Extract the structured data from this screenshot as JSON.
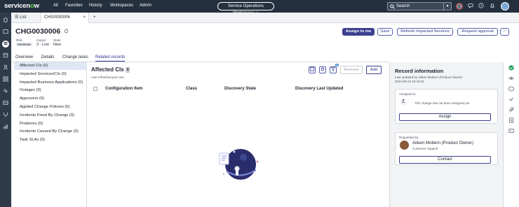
{
  "topnav": {
    "logo_prefix": "servicen",
    "logo_o": "o",
    "logo_suffix": "w",
    "links": [
      "All",
      "Favorites",
      "History",
      "Workspaces",
      "Admin"
    ],
    "workspace": "Service Operations Workspace",
    "workspace_star": "☆",
    "search_label": "Search"
  },
  "tabs": {
    "list": "List",
    "record": "CHG0030006",
    "close": "×",
    "add": "+"
  },
  "record": {
    "number": "CHG0030006",
    "risk_label": "Risk",
    "risk_value": "Moderate",
    "impact_label": "Impact",
    "impact_value": "3 - Low",
    "state_label": "State",
    "state_value": "New"
  },
  "actions": {
    "assign_to_me": "Assign to me",
    "save": "Save",
    "refresh": "Refresh Impacted Services",
    "request_approval": "Request approval",
    "more": "⋯"
  },
  "subtabs": [
    "Overview",
    "Details",
    "Change tasks",
    "Related records"
  ],
  "related_lists": [
    "Affected CIs (0)",
    "Impacted Services/CIs (0)",
    "Impacted Business Applications (0)",
    "Outages (0)",
    "Approvers (0)",
    "Applied Change Policies (0)",
    "Incidents Fixed By Change (0)",
    "Problems (0)",
    "Incidents Caused By Change (0)",
    "Task SLAs (0)"
  ],
  "panel": {
    "title": "Affected CIs",
    "count": "0",
    "refreshed": "Last refreshed just now",
    "filter_count": "1",
    "remove": "Remove",
    "add": "Add",
    "columns": [
      "Configuration Item",
      "Class",
      "Discovery State",
      "Discovery Last Updated"
    ]
  },
  "record_info": {
    "title": "Record information",
    "updated_by": "Last updated by Aileen Mottern (Product Owner)",
    "updated_at": "2024-09-23 16:42:04",
    "assigned_to_label": "Assigned to",
    "not_assigned": "This change has not been assigned yet",
    "assign_button": "Assign",
    "requested_by_label": "Requested by",
    "requester_name": "Aileen Mottern (Product Owner)",
    "requester_dept": "Customer Support",
    "contact_button": "Contact"
  },
  "colors": {
    "accent": "#3b3f8f",
    "nav": "#24303e",
    "sidebar": "#2f3b4a",
    "selected": "#dfe7f5",
    "success": "#1f9d55"
  }
}
